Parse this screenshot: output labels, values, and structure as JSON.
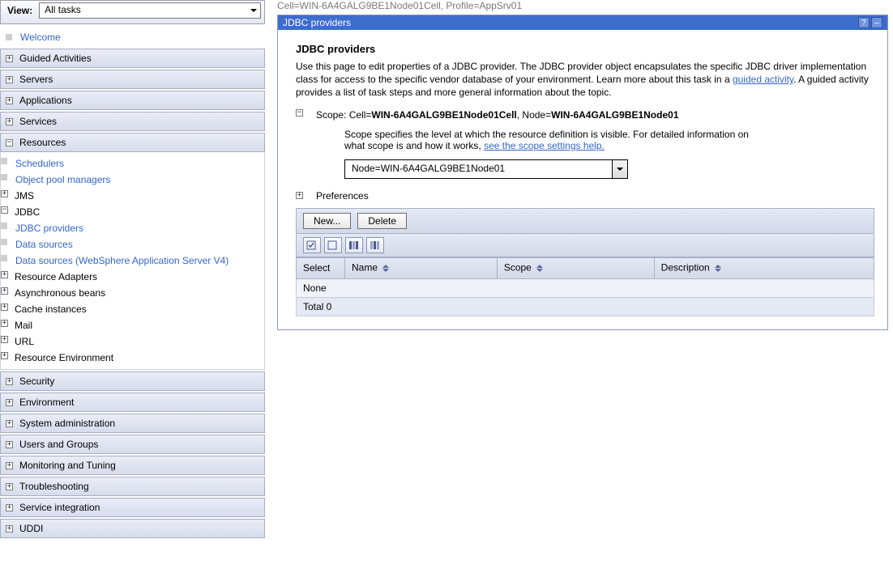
{
  "view": {
    "label": "View:",
    "selected": "All tasks"
  },
  "nav": {
    "welcome": "Welcome",
    "sections": [
      {
        "id": "guided",
        "label": "Guided Activities",
        "expanded": false
      },
      {
        "id": "servers",
        "label": "Servers",
        "expanded": false
      },
      {
        "id": "apps",
        "label": "Applications",
        "expanded": false
      },
      {
        "id": "services",
        "label": "Services",
        "expanded": false
      },
      {
        "id": "resources",
        "label": "Resources",
        "expanded": true
      },
      {
        "id": "security",
        "label": "Security",
        "expanded": false
      },
      {
        "id": "env",
        "label": "Environment",
        "expanded": false
      },
      {
        "id": "sysadmin",
        "label": "System administration",
        "expanded": false
      },
      {
        "id": "users",
        "label": "Users and Groups",
        "expanded": false
      },
      {
        "id": "monitor",
        "label": "Monitoring and Tuning",
        "expanded": false
      },
      {
        "id": "trouble",
        "label": "Troubleshooting",
        "expanded": false
      },
      {
        "id": "svcint",
        "label": "Service integration",
        "expanded": false
      },
      {
        "id": "uddi",
        "label": "UDDI",
        "expanded": false
      }
    ],
    "resources": {
      "schedulers": "Schedulers",
      "objectpool": "Object pool managers",
      "jms": "JMS",
      "jdbc": "JDBC",
      "jdbc_children": {
        "providers": "JDBC providers",
        "datasources": "Data sources",
        "datasources_v4": "Data sources (WebSphere Application Server V4)"
      },
      "resource_adapters": "Resource Adapters",
      "async_beans": "Asynchronous beans",
      "cache": "Cache instances",
      "mail": "Mail",
      "url": "URL",
      "res_env": "Resource Environment"
    }
  },
  "breadcrumb": "Cell=WIN-6A4GALG9BE1Node01Cell, Profile=AppSrv01",
  "panel": {
    "title": "JDBC providers",
    "heading": "JDBC providers",
    "desc_pre": "Use this page to edit properties of a JDBC provider. The JDBC provider object encapsulates the specific JDBC driver implementation class for access to the specific vendor database of your environment. Learn more about this task in a ",
    "desc_link": "guided activity",
    "desc_post": ". A guided activity provides a list of task steps and more general information about the topic.",
    "scope": {
      "label_pre": "Scope: Cell=",
      "cell": "WIN-6A4GALG9BE1Node01Cell",
      "node_pre": ", Node=",
      "node": "WIN-6A4GALG9BE1Node01",
      "help_pre": "Scope specifies the level at which the resource definition is visible. For detailed information on what scope is and how it works, ",
      "help_link": "see the scope settings help.",
      "select_value": "Node=WIN-6A4GALG9BE1Node01"
    },
    "preferences_label": "Preferences",
    "buttons": {
      "new": "New...",
      "delete": "Delete"
    },
    "columns": {
      "select": "Select",
      "name": "Name",
      "scope": "Scope",
      "description": "Description"
    },
    "rows": {
      "none": "None",
      "total": "Total 0"
    }
  }
}
